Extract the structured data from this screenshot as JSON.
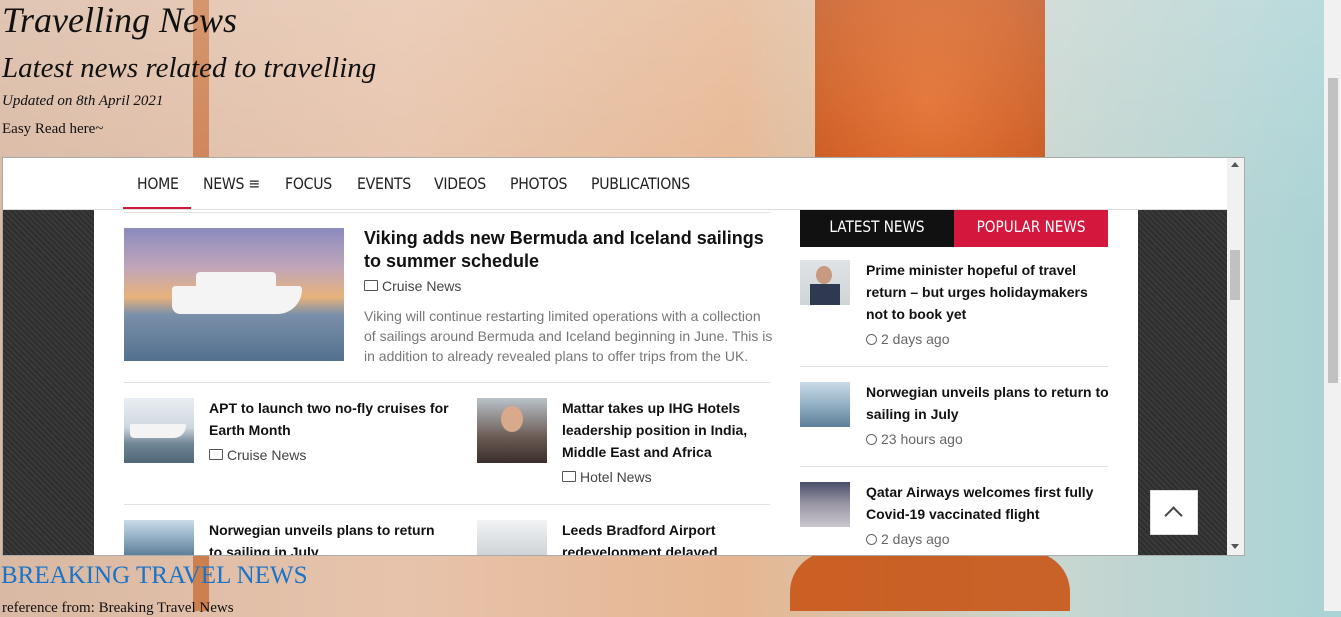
{
  "site": {
    "title": "Travelling News",
    "subtitle": "Latest news related to travelling",
    "updated": "Updated on 8th April 2021",
    "easy_read": "Easy Read here~"
  },
  "nav": {
    "items": [
      "HOME",
      "NEWS ≡",
      "FOCUS",
      "EVENTS",
      "VIDEOS",
      "PHOTOS",
      "PUBLICATIONS"
    ],
    "active": "HOME"
  },
  "featured": {
    "headline": "Viking adds new Bermuda and Iceland sailings to summer schedule",
    "category": "Cruise News",
    "excerpt": "Viking will continue restarting limited operations with a collection of sailings around Bermuda and Iceland beginning in June. This is in addition to already revealed plans to offer trips from the UK."
  },
  "articles": [
    {
      "headline": "APT to launch two no-fly cruises for Earth Month",
      "category": "Cruise News"
    },
    {
      "headline": "Mattar takes up IHG Hotels leadership position in India, Middle East and Africa",
      "category": "Hotel News"
    },
    {
      "headline": "Norwegian unveils plans to return to sailing in July",
      "category": ""
    },
    {
      "headline": "Leeds Bradford Airport redevelopment delayed",
      "category": ""
    }
  ],
  "sidebar": {
    "tabs": [
      "LATEST NEWS",
      "POPULAR NEWS"
    ],
    "items": [
      {
        "headline": "Prime minister hopeful of travel return – but urges holidaymakers not to book yet",
        "ago": "2 days ago"
      },
      {
        "headline": "Norwegian unveils plans to return to sailing in July",
        "ago": "23 hours ago"
      },
      {
        "headline": "Qatar Airways welcomes first fully Covid-19 vaccinated flight",
        "ago": "2 days ago"
      }
    ]
  },
  "footer": {
    "breaking_link": "BREAKING TRAVEL NEWS",
    "reference": "reference from: Breaking Travel News"
  },
  "colors": {
    "accent": "#d4173d",
    "link": "#1a73c9"
  }
}
